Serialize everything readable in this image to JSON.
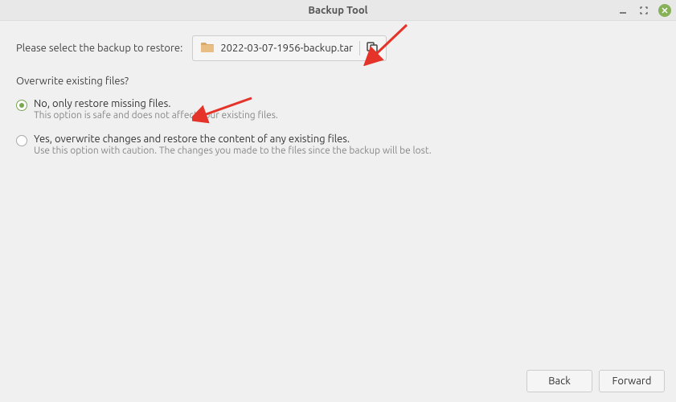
{
  "window": {
    "title": "Backup Tool"
  },
  "main": {
    "select_label": "Please select the backup to restore:",
    "file_name": "2022-03-07-1956-backup.tar",
    "overwrite_question": "Overwrite existing files?",
    "options": [
      {
        "title": "No, only restore missing files.",
        "desc": "This option is safe and does not affect your existing files.",
        "selected": true
      },
      {
        "title": "Yes, overwrite changes and restore the content of any existing files.",
        "desc": "Use this option with caution. The changes you made to the files since the backup will be lost.",
        "selected": false
      }
    ]
  },
  "footer": {
    "back": "Back",
    "forward": "Forward"
  }
}
